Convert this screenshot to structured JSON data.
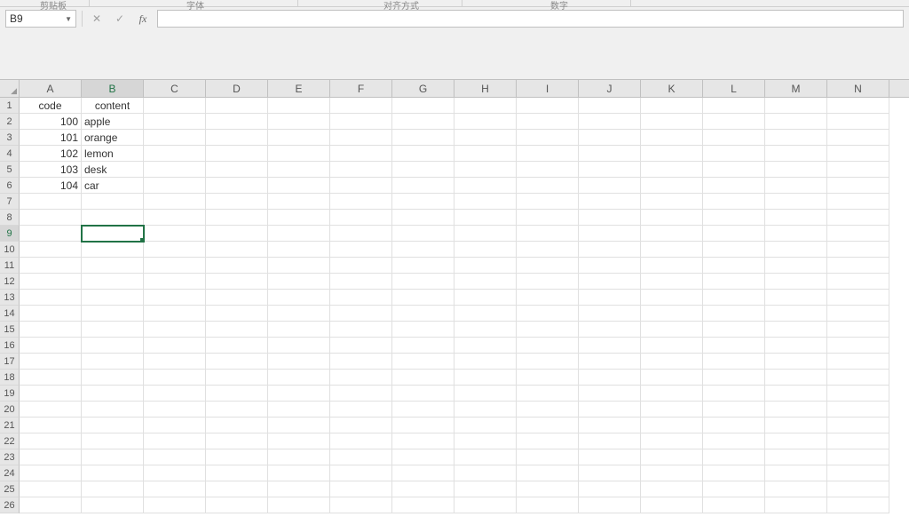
{
  "ribbon": {
    "groups": [
      "剪贴板",
      "字体",
      "对齐方式",
      "数字"
    ]
  },
  "formula_bar": {
    "name_box": "B9",
    "cancel": "✕",
    "enter": "✓",
    "fx": "fx",
    "formula": ""
  },
  "columns": [
    "A",
    "B",
    "C",
    "D",
    "E",
    "F",
    "G",
    "H",
    "I",
    "J",
    "K",
    "L",
    "M",
    "N"
  ],
  "row_count": 26,
  "selected": {
    "col": "B",
    "row": 9
  },
  "cells": {
    "A1": {
      "v": "code",
      "cls": "ctr"
    },
    "B1": {
      "v": "content",
      "cls": "ctr"
    },
    "A2": {
      "v": "100",
      "cls": "num"
    },
    "B2": {
      "v": "apple",
      "cls": "txt"
    },
    "A3": {
      "v": "101",
      "cls": "num"
    },
    "B3": {
      "v": "orange",
      "cls": "txt"
    },
    "A4": {
      "v": "102",
      "cls": "num"
    },
    "B4": {
      "v": "lemon",
      "cls": "txt"
    },
    "A5": {
      "v": "103",
      "cls": "num"
    },
    "B5": {
      "v": "desk",
      "cls": "txt"
    },
    "A6": {
      "v": "104",
      "cls": "num"
    },
    "B6": {
      "v": "car",
      "cls": "txt"
    }
  },
  "chart_data": {
    "type": "table",
    "columns": [
      "code",
      "content"
    ],
    "rows": [
      [
        100,
        "apple"
      ],
      [
        101,
        "orange"
      ],
      [
        102,
        "lemon"
      ],
      [
        103,
        "desk"
      ],
      [
        104,
        "car"
      ]
    ]
  }
}
